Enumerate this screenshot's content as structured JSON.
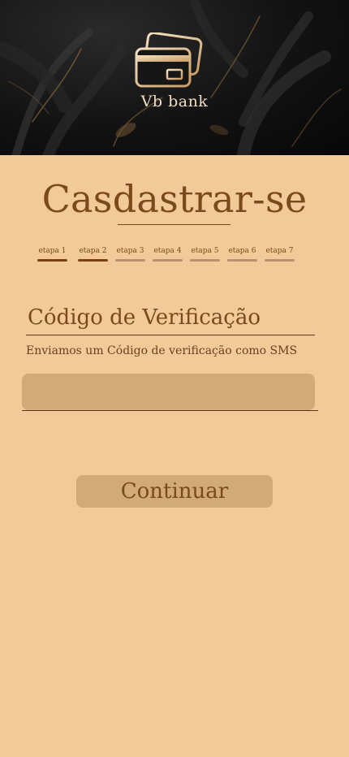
{
  "header": {
    "brand": "Vb bank",
    "logo_icon": "credit-cards-icon"
  },
  "page": {
    "title": "Casdastrar-se"
  },
  "steps": [
    {
      "label": "etapa 1",
      "done": true
    },
    {
      "label": "etapa 2",
      "done": true
    },
    {
      "label": "etapa 3",
      "done": false
    },
    {
      "label": "etapa 4",
      "done": false
    },
    {
      "label": "etapa 5",
      "done": false
    },
    {
      "label": "etapa 6",
      "done": false
    },
    {
      "label": "etapa 7",
      "done": false
    }
  ],
  "verification": {
    "title": "Código de Verificação",
    "hint": "Enviamos um Código de verificação como SMS",
    "code_value": "",
    "code_placeholder": ""
  },
  "actions": {
    "continue_label": "Continuar"
  },
  "colors": {
    "background": "#f2c999",
    "accent": "#7a4a1c",
    "field": "#d2aa78",
    "step_done": "#7a4113",
    "step_pending": "#b89370"
  }
}
